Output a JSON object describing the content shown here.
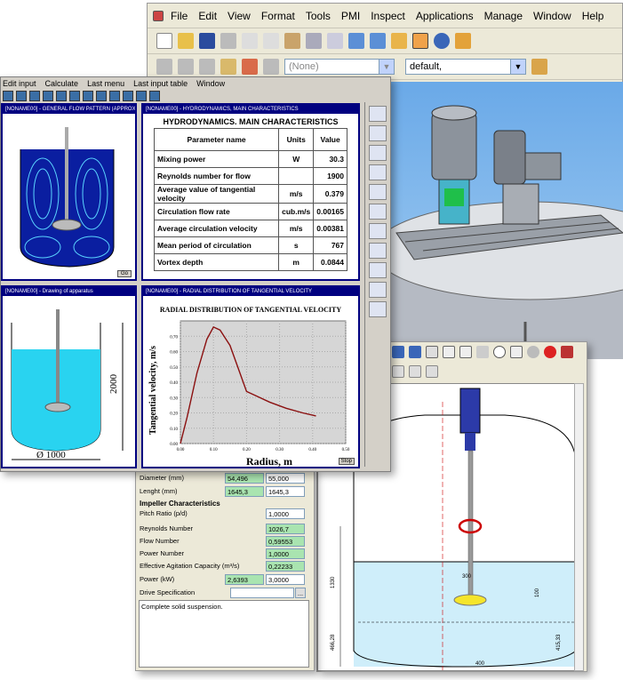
{
  "cad": {
    "menu": [
      "File",
      "Edit",
      "View",
      "Format",
      "Tools",
      "PMI",
      "Inspect",
      "Applications",
      "Manage",
      "Window",
      "Help"
    ],
    "layer_combo": "(None)",
    "style_combo": "default,"
  },
  "mixer": {
    "menu": [
      "Edit input",
      "Calculate",
      "Last menu",
      "Last input table",
      "Window"
    ],
    "flow_title": "[NONAME00] - GENERAL FLOW PATTERN (APPROXIMATE)",
    "flow_go": "Go",
    "drawing_title": "[NONAME00] - Drawing of apparatus",
    "drawing_dim_height": "2000",
    "drawing_dim_diameter": "Ø 1000",
    "hydro_title": "[NONAME00] - HYDRODYNAMICS, MAIN CHARACTERISTICS",
    "hydro_heading": "HYDRODYNAMICS. MAIN CHARACTERISTICS",
    "hydro_headers": [
      "Parameter name",
      "Units",
      "Value"
    ],
    "hydro_rows": [
      {
        "name": "Mixing power",
        "unit": "W",
        "value": "30.3"
      },
      {
        "name": "Reynolds number for flow",
        "unit": "",
        "value": "1900"
      },
      {
        "name": "Average value of tangential velocity",
        "unit": "m/s",
        "value": "0.379"
      },
      {
        "name": "Circulation flow rate",
        "unit": "cub.m/s",
        "value": "0.00165"
      },
      {
        "name": "Average circulation velocity",
        "unit": "m/s",
        "value": "0.00381"
      },
      {
        "name": "Mean period of circulation",
        "unit": "s",
        "value": "767"
      },
      {
        "name": "Vortex depth",
        "unit": "m",
        "value": "0.0844"
      }
    ],
    "chart_title_bar": "[NONAME00] - RADIAL DISTRIBUTION OF TANGENTIAL VELOCITY",
    "chart_stop": "Stop"
  },
  "chart_data": {
    "type": "line",
    "title": "RADIAL DISTRIBUTION OF TANGENTIAL VELOCITY",
    "xlabel": "Radius, m",
    "ylabel": "Tangential velocity, m/s",
    "xlim": [
      0,
      0.5
    ],
    "ylim": [
      0,
      0.8
    ],
    "x_ticks": [
      "0.00",
      "0.10",
      "0.20",
      "0.30",
      "0.40",
      "0.50"
    ],
    "y_ticks": [
      "0.00",
      "0.10",
      "0.20",
      "0.30",
      "0.40",
      "0.50",
      "0.60",
      "0.70"
    ],
    "grid": true,
    "series": [
      {
        "x": [
          0.0,
          0.02,
          0.05,
          0.08,
          0.1,
          0.12,
          0.15,
          0.18,
          0.2,
          0.23,
          0.27,
          0.32,
          0.37,
          0.41
        ],
        "y": [
          0.0,
          0.17,
          0.46,
          0.68,
          0.76,
          0.74,
          0.64,
          0.46,
          0.34,
          0.31,
          0.27,
          0.23,
          0.2,
          0.18
        ]
      }
    ]
  },
  "calc": {
    "rows": [
      {
        "label": "Diameter (mm)",
        "val1": "54,496",
        "val2": "55,000"
      },
      {
        "label": "Lenght (mm)",
        "val1": "1645,3",
        "val2": "1645,3"
      }
    ],
    "section": "Impeller Characteristics",
    "pitch_label": "Pitch Ratio (p/d)",
    "pitch_value": "1,0000",
    "outputs": [
      {
        "label": "Reynolds Number",
        "value": "1026,7"
      },
      {
        "label": "Flow Number",
        "value": "0,59553"
      },
      {
        "label": "Power Number",
        "value": "1,0000"
      },
      {
        "label": "Effective Agitation Capacity (m³/s)",
        "value": "0,22233"
      }
    ],
    "power_label": "Power (kW)",
    "power_val1": "2,6393",
    "power_val2": "3,0000",
    "drive_label": "Drive Specification",
    "drive_button": "...",
    "status": "Complete solid suspension."
  },
  "drawing": {
    "dims": [
      "1330",
      "300",
      "100",
      "466,28",
      "415,33",
      "400"
    ]
  }
}
